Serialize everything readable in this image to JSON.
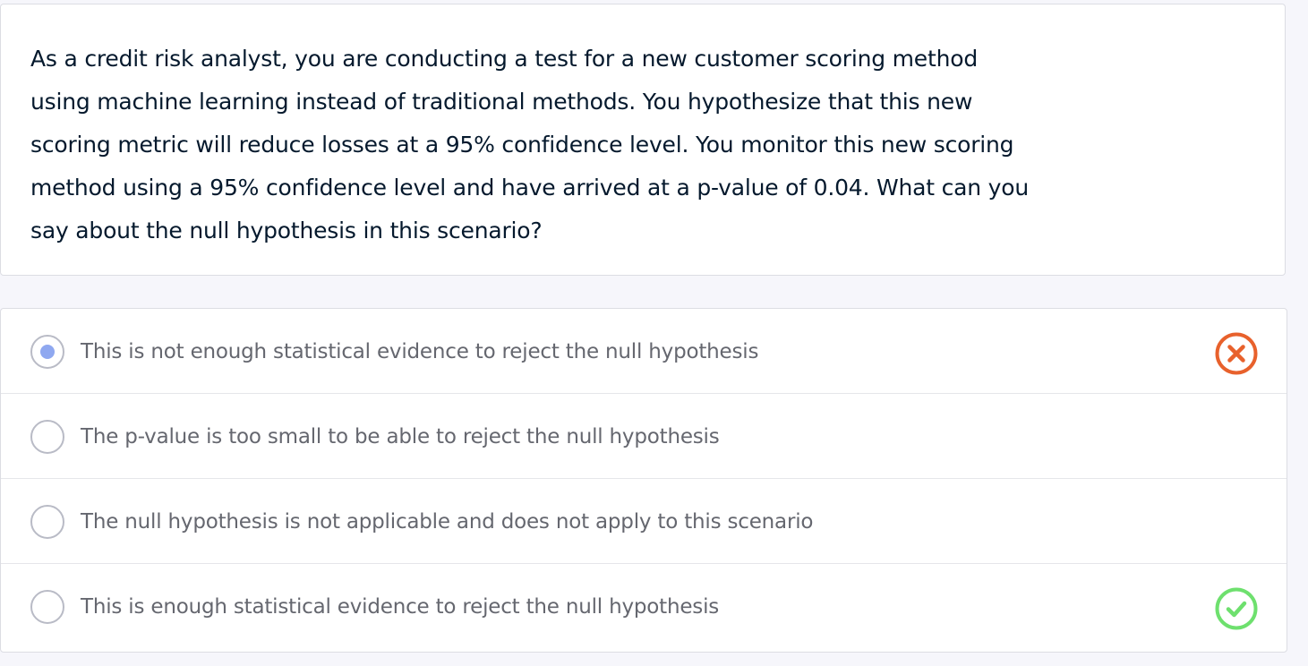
{
  "question": {
    "lines": [
      "As a credit risk analyst, you are conducting a test for a new customer scoring method",
      "using machine learning instead of traditional methods. You hypothesize that this new",
      "scoring metric will reduce losses at a 95% confidence level. You monitor this new scoring",
      "method using a 95% confidence level and have arrived at a p-value of 0.04. What can you",
      "say about the null hypothesis in this scenario?"
    ]
  },
  "options": [
    {
      "label": "This is not enough statistical evidence to reject the null hypothesis",
      "selected": true,
      "status": "incorrect",
      "status_icon": "x-circle-icon",
      "status_color": "#e8612c"
    },
    {
      "label": "The p-value is too small to be able to reject the null hypothesis",
      "selected": false,
      "status": null
    },
    {
      "label": "The null hypothesis is not applicable and does not apply to this scenario",
      "selected": false,
      "status": null
    },
    {
      "label": "This is enough statistical evidence to reject the null hypothesis",
      "selected": false,
      "status": "correct",
      "status_icon": "check-circle-icon",
      "status_color": "#6ee06e"
    }
  ],
  "colors": {
    "question_text": "#05192d",
    "option_text": "#65676f",
    "radio_selected_dot": "#8fa8f0",
    "page_background": "#f6f6fb"
  }
}
